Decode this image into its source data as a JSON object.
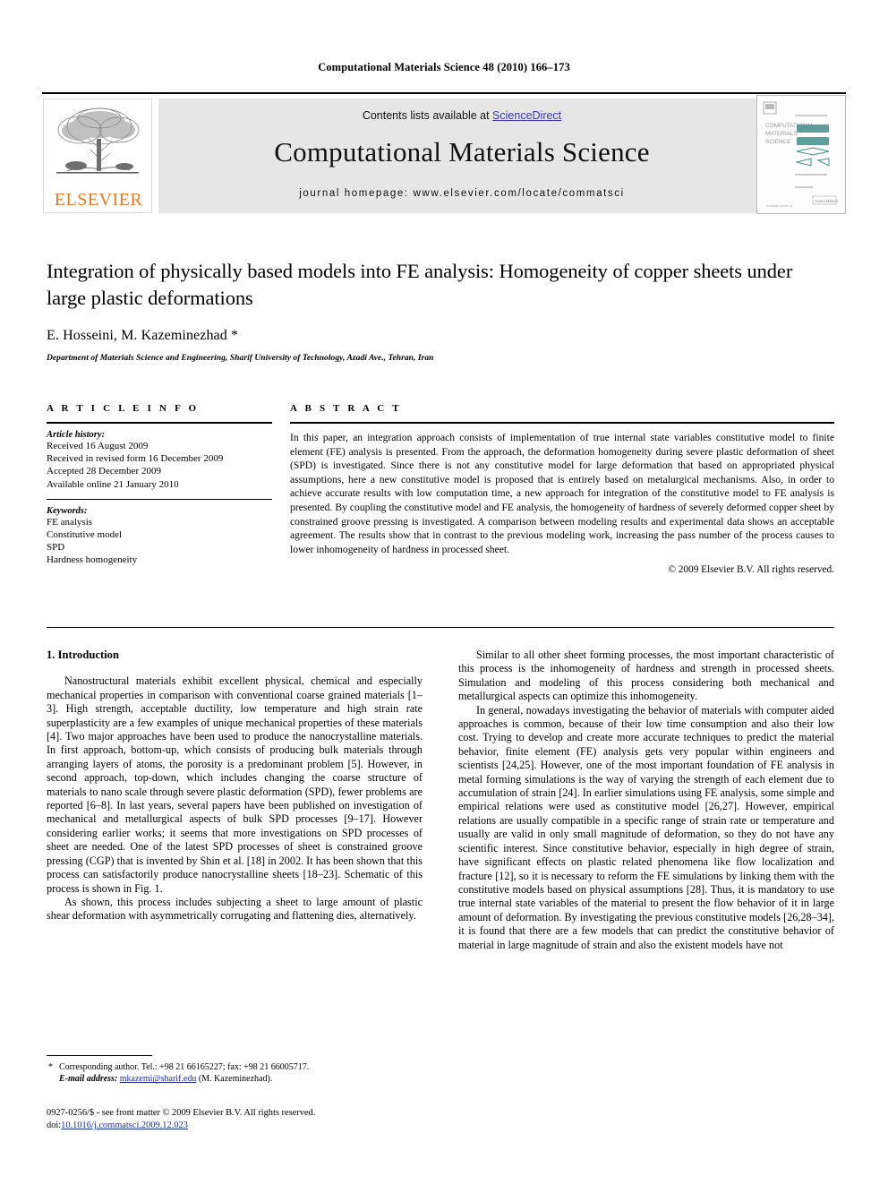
{
  "running_head": "Computational Materials Science 48 (2010) 166–173",
  "header": {
    "contents_prefix": "Contents lists available at ",
    "sciencedirect": "ScienceDirect",
    "journal_name": "Computational Materials Science",
    "homepage": "journal homepage: www.elsevier.com/locate/commatsci",
    "publisher_wordmark": "ELSEVIER",
    "cover_lines": [
      "COMPUTATIONAL",
      "MATERIALS",
      "SCIENCE"
    ],
    "accent_color": "#E87B25",
    "link_color": "#3a3ab0",
    "banner_bg": "#e6e6e6"
  },
  "title_block": {
    "title": "Integration of physically based models into FE analysis: Homogeneity of copper sheets under large plastic deformations",
    "authors": "E. Hosseini, M. Kazeminezhad *",
    "affiliation": "Department of Materials Science and Engineering, Sharif University of Technology, Azadi Ave., Tehran, Iran"
  },
  "article_info": {
    "heading": "A R T I C L E   I N F O",
    "history_label": "Article history:",
    "history": [
      "Received 16 August 2009",
      "Received in revised form 16 December 2009",
      "Accepted 28 December 2009",
      "Available online 21 January 2010"
    ],
    "keywords_label": "Keywords:",
    "keywords": [
      "FE analysis",
      "Constitutive model",
      "SPD",
      "Hardness homogeneity"
    ]
  },
  "abstract": {
    "heading": "A B S T R A C T",
    "text": "In this paper, an integration approach consists of implementation of true internal state variables constitutive model to finite element (FE) analysis is presented. From the approach, the deformation homogeneity during severe plastic deformation of sheet (SPD) is investigated. Since there is not any constitutive model for large deformation that based on appropriated physical assumptions, here a new constitutive model is proposed that is entirely based on metalurgical mechanisms. Also, in order to achieve accurate results with low computation time, a new approach for integration of the constitutive model to FE analysis is presented. By coupling the constitutive model and FE analysis, the homogeneity of hardness of severely deformed copper sheet by constrained groove pressing is investigated. A comparison between modeling results and experimental data shows an acceptable agreement. The results show that in contrast to the previous modeling work, increasing the pass number of the process causes to lower inhomogeneity of hardness in processed sheet.",
    "copyright": "© 2009 Elsevier B.V. All rights reserved."
  },
  "body": {
    "section_title": "1. Introduction",
    "left_paragraphs": [
      "Nanostructural materials exhibit excellent physical, chemical and especially mechanical properties in comparison with conventional coarse grained materials [1–3]. High strength, acceptable ductility, low temperature and high strain rate superplasticity are a few examples of unique mechanical properties of these materials [4]. Two major approaches have been used to produce the nanocrystalline materials. In first approach, bottom-up, which consists of producing bulk materials through arranging layers of atoms, the porosity is a predominant problem [5]. However, in second approach, top-down, which includes changing the coarse structure of materials to nano scale through severe plastic deformation (SPD), fewer problems are reported [6–8]. In last years, several papers have been published on investigation of mechanical and metallurgical aspects of bulk SPD processes [9–17]. However considering earlier works; it seems that more investigations on SPD processes of sheet are needed. One of the latest SPD processes of sheet is constrained groove pressing (CGP) that is invented by Shin et al. [18] in 2002. It has been shown that this process can satisfactorily produce nanocrystalline sheets [18–23]. Schematic of this process is shown in Fig. 1.",
      "As shown, this process includes subjecting a sheet to large amount of plastic shear deformation with asymmetrically corrugating and flattening dies, alternatively."
    ],
    "right_paragraphs": [
      "Similar to all other sheet forming processes, the most important characteristic of this process is the inhomogeneity of hardness and strength in processed sheets. Simulation and modeling of this process considering both mechanical and metallurgical aspects can optimize this inhomogeneity.",
      "In general, nowadays investigating the behavior of materials with computer aided approaches is common, because of their low time consumption and also their low cost. Trying to develop and create more accurate techniques to predict the material behavior, finite element (FE) analysis gets very popular within engineers and scientists [24,25]. However, one of the most important foundation of FE analysis in metal forming simulations is the way of varying the strength of each element due to accumulation of strain [24]. In earlier simulations using FE analysis, some simple and empirical relations were used as constitutive model [26,27]. However, empirical relations are usually compatible in a specific range of strain rate or temperature and usually are valid in only small magnitude of deformation, so they do not have any scientific interest. Since constitutive behavior, especially in high degree of strain, have significant effects on plastic related phenomena like flow localization and fracture [12], so it is necessary to reform the FE simulations by linking them with the constitutive models based on physical assumptions [28]. Thus, it is mandatory to use true internal state variables of the material to present the flow behavior of it in large amount of deformation. By investigating the previous constitutive models [26,28–34], it is found that there are a few models that can predict the constitutive behavior of material in large magnitude of strain and also the existent models have not"
    ]
  },
  "footnote": {
    "marker": "*",
    "line1": "Corresponding author. Tel.: +98 21 66165227; fax: +98 21 66005717.",
    "email_label": "E-mail address:",
    "email": "mkazemi@sharif.edu",
    "email_owner": "(M. Kazeminezhad)."
  },
  "issn_footer": {
    "line1": "0927-0256/$ - see front matter © 2009 Elsevier B.V. All rights reserved.",
    "doi_label": "doi:",
    "doi": "10.1016/j.commatsci.2009.12.023"
  }
}
